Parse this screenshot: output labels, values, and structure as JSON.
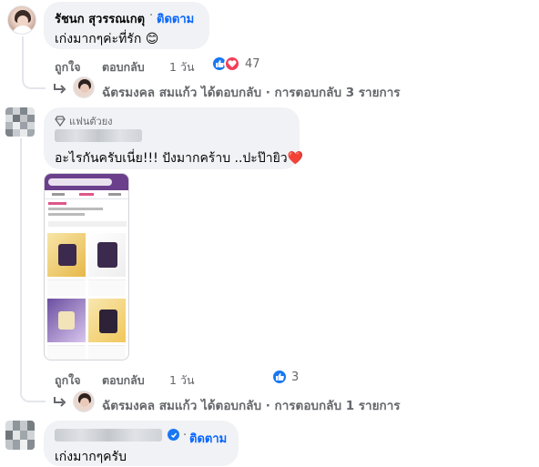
{
  "comment1": {
    "author": "รัชนก สุวรรณเกตุ",
    "follow_label": "ติดตาม",
    "text": "เก่งมากๆค่ะที่รัก",
    "emoji": "😊",
    "like_label": "ถูกใจ",
    "reply_label": "ตอบกลับ",
    "time": "1 วัน",
    "reaction_count": "47",
    "replies_text": "ฉัตรมงคล สมแก้ว ได้ตอบกลับ · การตอบกลับ 3 รายการ"
  },
  "comment2": {
    "badge": "แฟนตัวยง",
    "text": "อะไรกันครับเนี่ย!!! ปังมากคร้าบ ..ปะป๊ายิว",
    "heart": "❤️",
    "like_label": "ถูกใจ",
    "reply_label": "ตอบกลับ",
    "time": "1 วัน",
    "reaction_count": "3",
    "replies_text": "ฉัตรมงคล สมแก้ว ได้ตอบกลับ · การตอบกลับ 1 รายการ"
  },
  "comment3": {
    "follow_label": "ติดตาม",
    "text": "เก่งมากๆครับ"
  },
  "colors": {
    "link_blue": "#0866ff",
    "like_blue": "#1877f2",
    "love_red": "#f33e58",
    "bubble_bg": "#f0f2f5",
    "meta_gray": "#65676b"
  }
}
